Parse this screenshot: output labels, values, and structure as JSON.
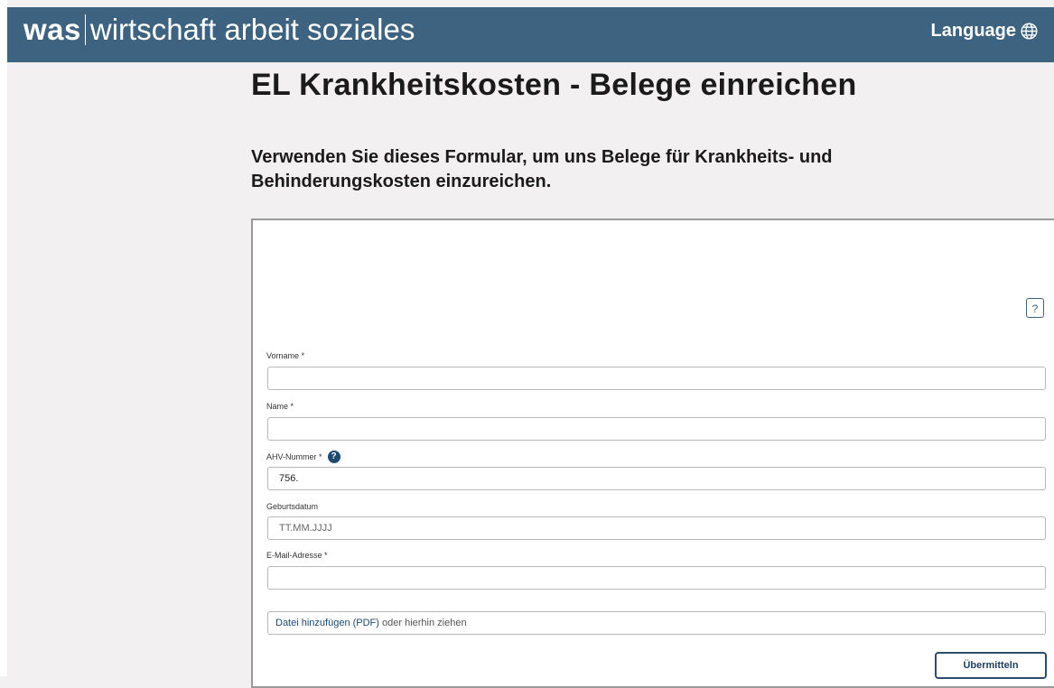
{
  "header": {
    "logo_bold": "was",
    "logo_text": "wirtschaft arbeit soziales",
    "language_label": "Language"
  },
  "page": {
    "title": "EL Krankheitskosten - Belege einreichen",
    "intro": "Verwenden Sie dieses Formular, um uns Belege für Krankheits- und Behinderungskosten einzureichen."
  },
  "form": {
    "help_label": "?",
    "fields": {
      "vorname": {
        "label": "Vorname *",
        "value": ""
      },
      "name": {
        "label": "Name *",
        "value": ""
      },
      "ahv": {
        "label": "AHV-Nummer *",
        "value": "756.",
        "info": "?"
      },
      "geburtsdatum": {
        "label": "Geburtsdatum",
        "placeholder": "TT.MM.JJJJ"
      },
      "email": {
        "label": "E-Mail-Adresse *",
        "value": ""
      }
    },
    "upload": {
      "link_text": "Datei hinzufügen (PDF)",
      "suffix": "oder hierhin ziehen"
    },
    "submit_label": "Übermitteln"
  },
  "colors": {
    "header_bg": "#3d6380",
    "page_bg": "#f2f0f0",
    "accent": "#1e4a70"
  }
}
